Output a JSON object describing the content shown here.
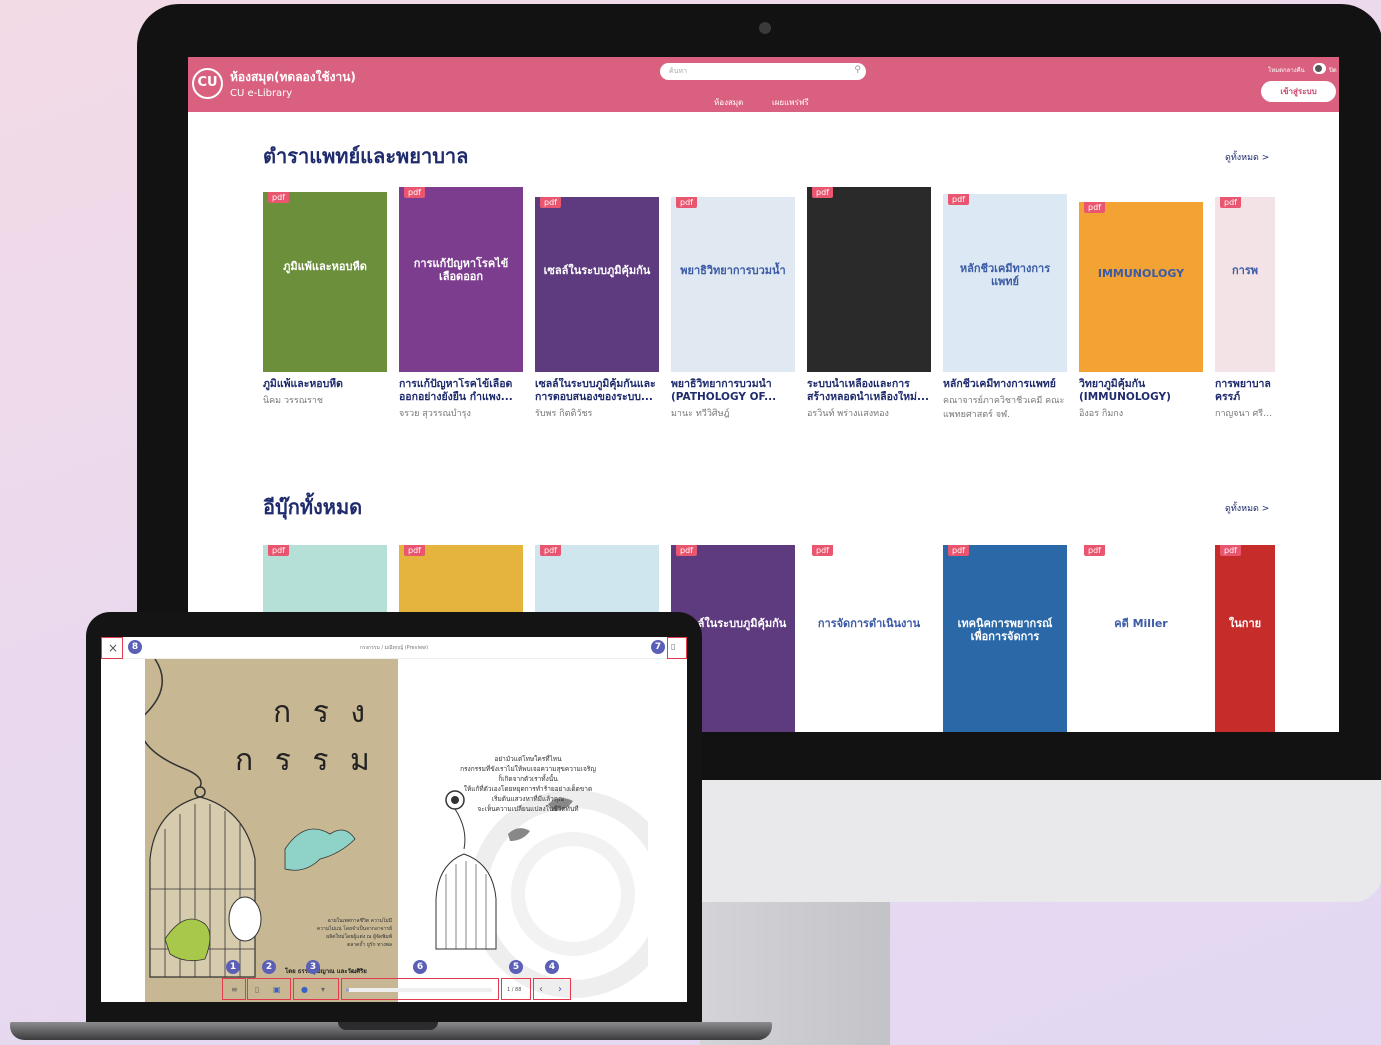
{
  "header": {
    "logo_text": "CU",
    "site_title": "ห้องสมุด(ทดลองใช้งาน)",
    "site_subtitle": "CU e-Library",
    "search_placeholder": "ค้นหา",
    "nav": [
      "ห้องสมุด",
      "เผยแพร่ฟรี"
    ],
    "dark_mode_label": "โหมดกลางคืน",
    "dark_mode_state": "ปิด",
    "login_label": "เข้าสู่ระบบ"
  },
  "sections": [
    {
      "title": "ตำราแพทย์และพยาบาล",
      "see_all": "ดูทั้งหมด >",
      "books": [
        {
          "tag": "pdf",
          "cover_text": "ภูมิแพ้และหอบหืด",
          "title": "ภูมิแพ้และหอบหืด",
          "author": "นิคม วรรณราช",
          "color": "#6b8f3a"
        },
        {
          "tag": "pdf",
          "cover_text": "การแก้ปัญหาโรคไข้เลือดออก",
          "title": "การแก้ปัญหาโรคไข้เลือด",
          "title2": "ออกอย่างยั่งยืน กำแพง...",
          "author": "จรวย สุวรรณบำรุง",
          "color": "#7d3d8f"
        },
        {
          "tag": "pdf",
          "cover_text": "เซลล์ในระบบภูมิคุ้มกัน",
          "title": "เซลล์ในระบบภูมิคุ้มกันและ",
          "title2": "การตอบสนองของระบบ...",
          "author": "รับพร กิตติวัชร",
          "color": "#5e3a7e"
        },
        {
          "tag": "pdf",
          "cover_text": "พยาธิวิทยาการบวมน้ำ",
          "title": "พยาธิวิทยาการบวมน้ำ",
          "title2": "(PATHOLOGY OF...",
          "author": "มานะ ทวีวิศิษฎ์",
          "color": "#e0e8f1"
        },
        {
          "tag": "pdf",
          "cover_text": "",
          "title": "ระบบน้ำเหลืองและการ",
          "title2": "สร้างหลอดน้ำเหลืองใหม่...",
          "author": "อรวินท์ พร่างแสงทอง",
          "color": "#2a2a2a"
        },
        {
          "tag": "pdf",
          "cover_text": "หลักชีวเคมีทางการแพทย์",
          "title": "หลักชีวเคมีทางการแพทย์",
          "title2": "",
          "author": "คณาจารย์ภาควิชาชีวเคมี คณะ",
          "author2": "แพทยศาสตร์ จฬ.",
          "color": "#dce9f4"
        },
        {
          "tag": "pdf",
          "cover_text": "IMMUNOLOGY",
          "title": "วิทยาภูมิคุ้มกัน",
          "title2": "(IMMUNOLOGY)",
          "author": "อิงอร กิมกง",
          "color": "#f3a234"
        },
        {
          "tag": "pdf",
          "cover_text": "การพ",
          "title": "การพยาบาล",
          "title2": "ครรภ์",
          "author": "กาญจนา ศรีสวัสดิ์",
          "color": "#f4e3e6"
        }
      ]
    },
    {
      "title": "อีบุ๊กทั้งหมด",
      "see_all": "ดูทั้งหมด >",
      "books": [
        {
          "tag": "pdf",
          "cover_text": "",
          "color": "#b5e0d8"
        },
        {
          "tag": "pdf",
          "cover_text": "",
          "color": "#e4b43c"
        },
        {
          "tag": "pdf",
          "cover_text": "",
          "color": "#cfe6ee"
        },
        {
          "tag": "pdf",
          "cover_text": "เซลล์ในระบบภูมิคุ้มกัน",
          "color": "#5e3a7e"
        },
        {
          "tag": "pdf",
          "cover_text": "การจัดการดำเนินงาน",
          "color": "#ffffff"
        },
        {
          "tag": "pdf",
          "cover_text": "เทคนิคการพยากรณ์เพื่อการจัดการ",
          "color": "#2a68a8"
        },
        {
          "tag": "pdf",
          "cover_text": "คดี Miller",
          "color": "#ffffff"
        },
        {
          "tag": "pdf",
          "cover_text": "ในกาย",
          "color": "#c62c2a"
        }
      ]
    }
  ],
  "reader": {
    "close_label": "×",
    "title": "กรงกรรม / มณีทุกุญ์ (Preview)",
    "bookmark_icon": "bookmark-icon",
    "left_heading_1": "ก ร ง",
    "left_heading_2": "ก ร ร ม",
    "poem": [
      "อย่ามัวแต่โทษใครที่ไหน",
      "กรงกรรมที่ขังเราไม่ให้พบเจอความสุขความเจริญ",
      "ก็เกิดจากตัวเราทั้งนั้น",
      "ให้แก้ที่ตัวเองโดยหยุดการทำร้ายอย่างเด็ดขาด",
      "เริ่มต้นแสวงหาที่มีแล้วคุณ",
      "จะเห็นความเปลี่ยนแปลงในชีวิตทันที"
    ],
    "credits": [
      "ฉายในเทศกาลชีวิต ความไม่มี",
      "ความไม่แน่ โดยจำเป็นจากอาจารย์",
      "ผลิตใหม่โดยผู้แต่ง ณ ผู้จัดพิมพ์",
      "ตลาดถ้ำ ยูรัก ทางพล"
    ],
    "byline": "โดย ธรรมวุฒิญาณ และวัฒศิริย",
    "page_indicator": "1 / 88",
    "markers": [
      "1",
      "2",
      "3",
      "4",
      "5",
      "6",
      "7",
      "8"
    ]
  }
}
